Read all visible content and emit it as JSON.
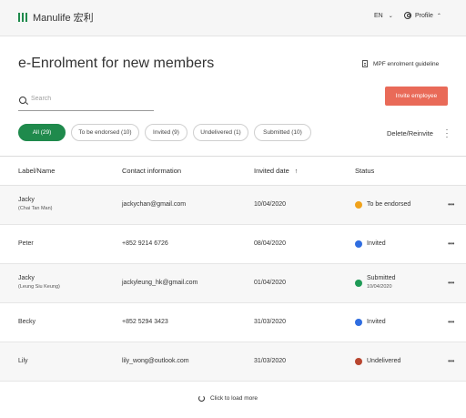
{
  "header": {
    "brand": "Manulife 宏利",
    "language": "EN",
    "profile_label": "Profile",
    "brand_color": "#1f8a4c"
  },
  "page": {
    "title": "e-Enrolment for new members",
    "guideline_link": "MPF enrolment guideline",
    "search_placeholder": "Search",
    "invite_button": "Invite employee",
    "invite_button_color": "#e96a58"
  },
  "filters": [
    {
      "label": "All (29)",
      "active": true
    },
    {
      "label": "To be endorsed (10)",
      "active": false
    },
    {
      "label": "Invited (9)",
      "active": false
    },
    {
      "label": "Undelivered (1)",
      "active": false
    },
    {
      "label": "Submitted (10)",
      "active": false
    }
  ],
  "actions": {
    "delete_reinvite": "Delete/Reinvite"
  },
  "table": {
    "columns": [
      "Label/Name",
      "Contact information",
      "Invited date",
      "Status"
    ],
    "rows": [
      {
        "name": "Jacky",
        "subname": "(Chai Tan Man)",
        "contact": "jackychan@gmail.com",
        "date": "10/04/2020",
        "status": "To be endorsed",
        "status_date": "",
        "status_color": "#f0a21b"
      },
      {
        "name": "Peter",
        "subname": "",
        "contact": "+852 9214 6726",
        "date": "08/04/2020",
        "status": "Invited",
        "status_date": "",
        "status_color": "#2f6de0"
      },
      {
        "name": "Jacky",
        "subname": "(Leung Siu Keung)",
        "contact": "jackyleung_hk@gmail.com",
        "date": "01/04/2020",
        "status": "Submitted",
        "status_date": "10/04/2020",
        "status_color": "#1f9a56"
      },
      {
        "name": "Becky",
        "subname": "",
        "contact": "+852 5294 3423",
        "date": "31/03/2020",
        "status": "Invited",
        "status_date": "",
        "status_color": "#2f6de0"
      },
      {
        "name": "Lily",
        "subname": "",
        "contact": "lily_wong@outlook.com",
        "date": "31/03/2020",
        "status": "Undelivered",
        "status_date": "",
        "status_color": "#b8452f"
      }
    ]
  },
  "footer": {
    "load_more": "Click to load more"
  }
}
